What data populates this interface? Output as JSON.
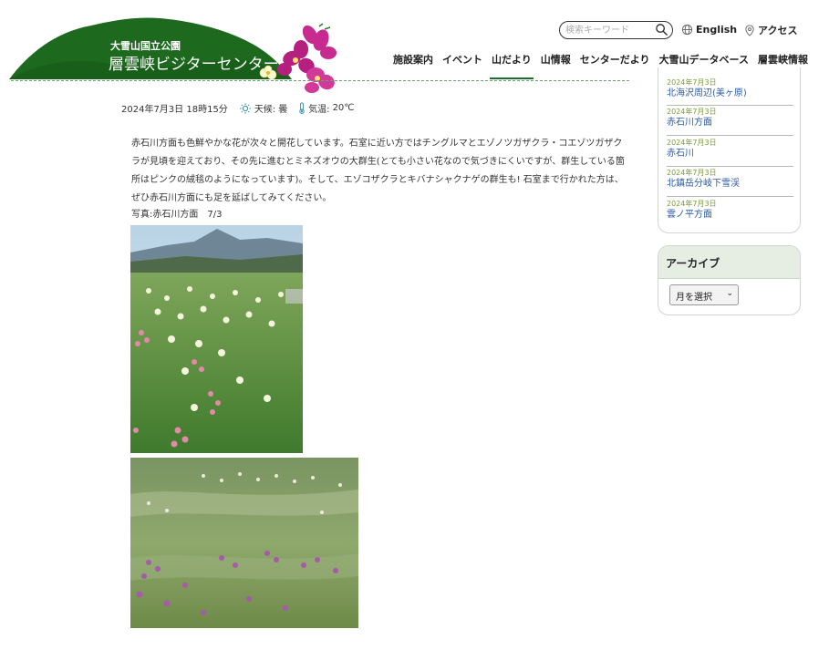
{
  "header": {
    "logo_sub": "大雪山国立公園",
    "logo_main": "層雲峡ビジターセンター",
    "search_placeholder": "検索キーワード",
    "lang_label": "English",
    "access_label": "アクセス",
    "nav": [
      {
        "label": "施設案内",
        "active": false
      },
      {
        "label": "イベント",
        "active": false
      },
      {
        "label": "山だより",
        "active": true
      },
      {
        "label": "山情報",
        "active": false
      },
      {
        "label": "センターだより",
        "active": false
      },
      {
        "label": "大雪山データベース",
        "active": false
      },
      {
        "label": "層雲峡情報",
        "active": false
      }
    ]
  },
  "post": {
    "datetime": "2024年7月3日 18時15分",
    "weather_label": "天候:",
    "weather_value": "曇",
    "temp_label": "気温:",
    "temp_value": "20℃",
    "body": "赤石川方面も色鮮やかな花が次々と開花しています。石室に近い方ではチングルマとエゾノツガザクラ・コエゾツガザクラが見頃を迎えており、その先に進むとミネズオウの大群生(とても小さい花なので気づきにくいですが、群生している箇所はピンクの絨毯のようになっています)。そして、エゾコザクラとキバナシャクナゲの群生も! 石室まで行かれた方は、ぜひ赤石川方面にも足を延ばしてみてください。",
    "photo_caption": "写真:赤石川方面　7/3"
  },
  "sidebar": {
    "recent": [
      {
        "date": "2024年7月3日",
        "title": "北海沢周辺(美ヶ原)"
      },
      {
        "date": "2024年7月3日",
        "title": "赤石川方面"
      },
      {
        "date": "2024年7月3日",
        "title": "赤石川"
      },
      {
        "date": "2024年7月3日",
        "title": "北鎮岳分岐下雪渓"
      },
      {
        "date": "2024年7月3日",
        "title": "雲ノ平方面"
      }
    ],
    "archive_title": "アーカイブ",
    "archive_select": "月を選択"
  },
  "colors": {
    "brand_green": "#1f6b2e",
    "link_blue": "#2a5ba8",
    "date_green": "#7a9a3a"
  },
  "icons": {
    "search": "search-icon",
    "globe": "globe-icon",
    "pin": "location-pin-icon",
    "weather": "sun-cloud-icon",
    "temperature": "thermometer-icon"
  }
}
